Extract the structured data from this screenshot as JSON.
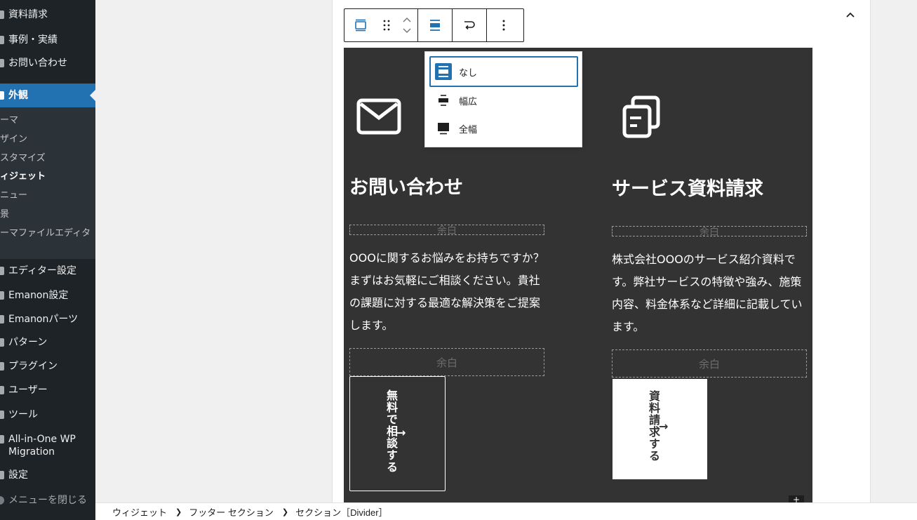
{
  "sidebar": {
    "items_top": [
      "資料請求",
      "事例・実績",
      "お問い合わせ"
    ],
    "active": "外観",
    "submenu": [
      "ーマ",
      "ザイン",
      "スタマイズ",
      "ィジェット",
      "ニュー",
      "景",
      "ーマファイルエディタ"
    ],
    "items_bottom": [
      "エディター設定",
      "Emanon設定",
      "Emanonパーツ",
      "パターン",
      "プラグイン",
      "ユーザー",
      "ツール",
      "All-in-One WP Migration",
      "設定"
    ],
    "collapse_label": "メニューを閉じる"
  },
  "toolbar": {
    "icons": [
      "group-icon",
      "drag-handle-icon",
      "move-up-icon",
      "move-down-icon",
      "align-none-icon",
      "transform-icon",
      "more-options-icon"
    ]
  },
  "align_menu": {
    "options": [
      {
        "label": "なし",
        "icon": "align-none-icon",
        "selected": true
      },
      {
        "label": "幅広",
        "icon": "align-wide-icon",
        "selected": false
      },
      {
        "label": "全幅",
        "icon": "align-full-icon",
        "selected": false
      }
    ]
  },
  "section": {
    "left": {
      "icon": "mail-icon",
      "heading": "お問い合わせ",
      "spacer_label_top": "余白",
      "text": "OOOに関するお悩みをお持ちですか？まずはお気軽にご相談ください。貴社の課題に対する最適な解決策をご提案します。",
      "spacer_label_bottom": "余白",
      "button_label": "無料で相談する",
      "button_arrow": "→"
    },
    "right": {
      "icon": "document-copy-icon",
      "heading": "サービス資料請求",
      "spacer_label_top": "余白",
      "text": "株式会社OOOのサービス紹介資料です。弊社サービスの特徴や強み、施策内容、料金体系など詳細に記載しています。",
      "spacer_label_bottom": "余白",
      "button_label": "資料請求する",
      "button_arrow": "→"
    },
    "colors": {
      "background": "#333333",
      "text": "#ffffff",
      "accent": "#2271b1"
    }
  },
  "breadcrumb": {
    "items": [
      "ウィジェット",
      "フッター セクション",
      "セクション［Divider］"
    ]
  }
}
